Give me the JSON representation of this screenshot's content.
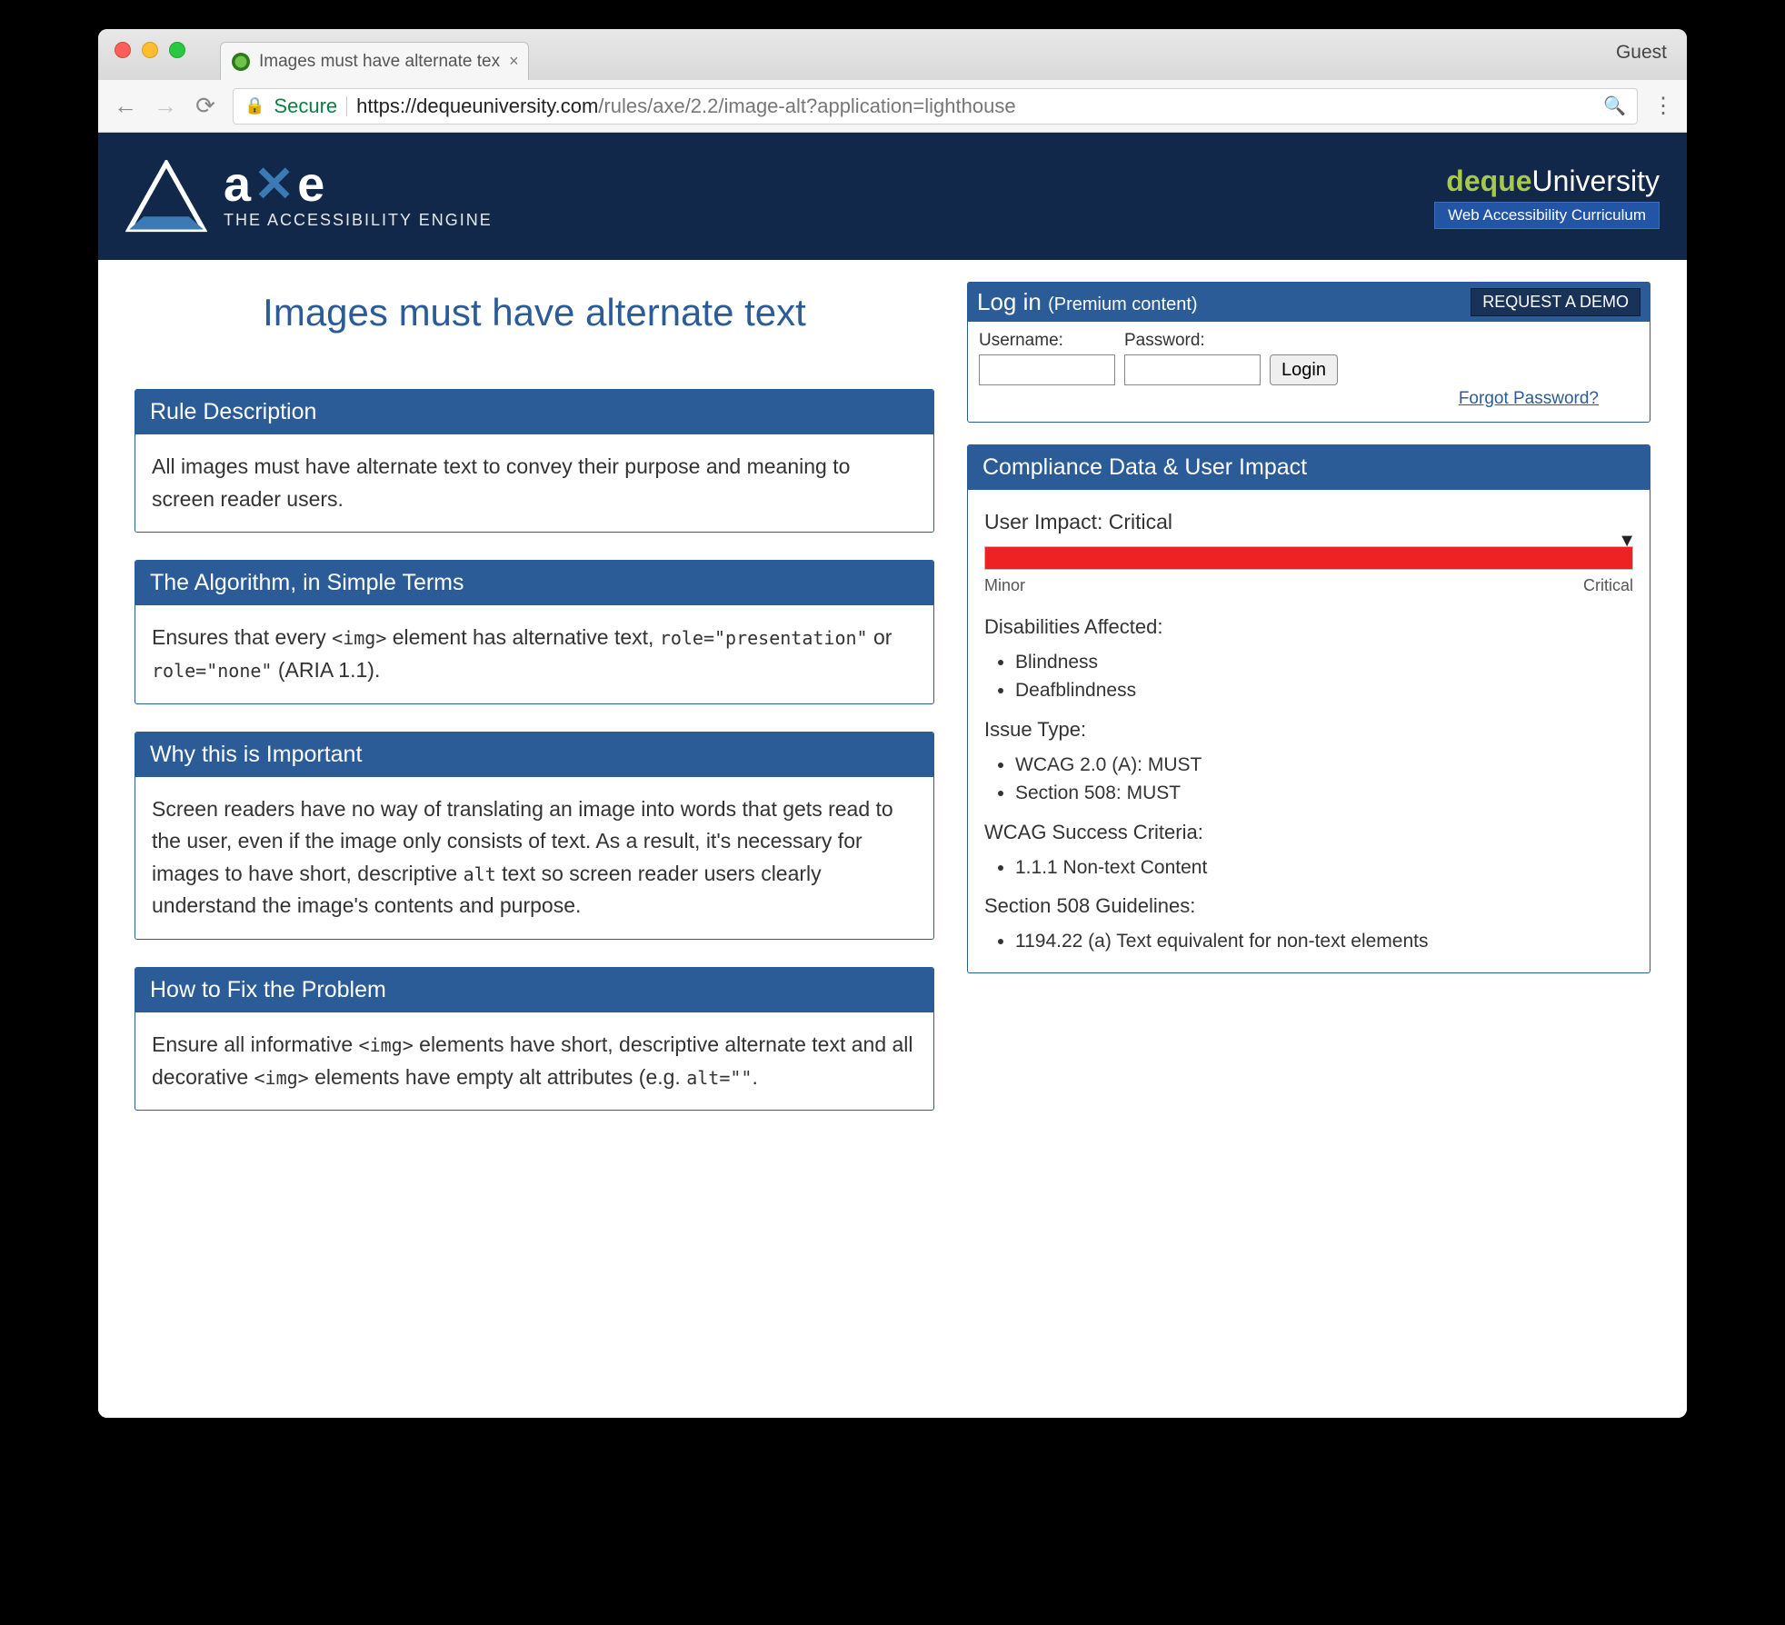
{
  "browser": {
    "tab_title": "Images must have alternate tex",
    "guest": "Guest",
    "secure": "Secure",
    "url_host": "https://dequeuniversity.com",
    "url_path": "/rules/axe/2.2/image-alt?application=lighthouse"
  },
  "banner": {
    "logo_word_a": "a",
    "logo_word_x": "✕",
    "logo_word_e": "e",
    "logo_tag": "THE ACCESSIBILITY ENGINE",
    "du_deque": "deque",
    "du_university": "University",
    "du_bar": "Web Accessibility Curriculum"
  },
  "page": {
    "title": "Images must have alternate text"
  },
  "login": {
    "heading": "Log in",
    "subheading": "(Premium content)",
    "demo": "REQUEST A DEMO",
    "username_label": "Username:",
    "password_label": "Password:",
    "login_btn": "Login",
    "forgot": "Forgot Password?"
  },
  "cards": {
    "rule": {
      "h": "Rule Description",
      "b": "All images must have alternate text to convey their purpose and meaning to screen reader users."
    },
    "algo": {
      "h": "The Algorithm, in Simple Terms",
      "b1": "Ensures that every ",
      "code1": "<img>",
      "b2": " element has alternative text, ",
      "code2": "role=\"presentation\"",
      "b3": " or ",
      "code3": "role=\"none\"",
      "b4": " (ARIA 1.1)."
    },
    "why": {
      "h": "Why this is Important",
      "b1": "Screen readers have no way of translating an image into words that gets read to the user, even if the image only consists of text. As a result, it's necessary for images to have short, descriptive ",
      "code1": "alt",
      "b2": " text so screen reader users clearly understand the image's contents and purpose."
    },
    "fix": {
      "h": "How to Fix the Problem",
      "b1": "Ensure all informative ",
      "code1": "<img>",
      "b2": " elements have short, descriptive alternate text and all decorative ",
      "code2": "<img>",
      "b3": " elements have empty alt attributes (e.g. ",
      "code3": "alt=\"\"",
      "b4": "."
    }
  },
  "sidebar": {
    "h": "Compliance Data & User Impact",
    "impact_label": "User Impact:",
    "impact_value": "Critical",
    "minor": "Minor",
    "critical": "Critical",
    "disabilities_h": "Disabilities Affected:",
    "disabilities": [
      "Blindness",
      "Deafblindness"
    ],
    "issue_h": "Issue Type:",
    "issues": [
      "WCAG 2.0 (A): MUST",
      "Section 508: MUST"
    ],
    "wcag_h": "WCAG Success Criteria:",
    "wcag": [
      "1.1.1 Non-text Content"
    ],
    "s508_h": "Section 508 Guidelines:",
    "s508": [
      "1194.22 (a) Text equivalent for non-text elements"
    ]
  }
}
